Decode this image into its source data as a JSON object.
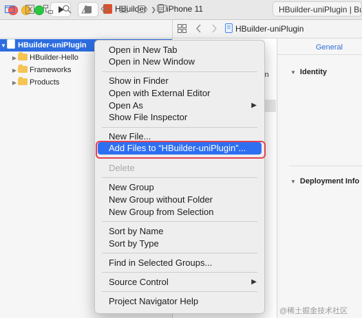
{
  "toolbar": {
    "run_icon": "play-icon",
    "stop_icon": "stop-icon",
    "scheme_name": "HBuilder",
    "scheme_separator": "❯",
    "device_name": "iPhone 11",
    "status_text": "HBuilder-uniPlugin | Build"
  },
  "navigator": {
    "icons": [
      "folder-icon",
      "source-control-icon",
      "hierarchy-icon",
      "search-icon",
      "warning-icon",
      "test-icon",
      "debug-icon",
      "breakpoint-icon",
      "report-icon"
    ],
    "tree": [
      {
        "label": "HBuilder-uniPlugin",
        "selected": true
      },
      {
        "label": "HBuilder-Hello"
      },
      {
        "label": "Frameworks"
      },
      {
        "label": "Products"
      }
    ]
  },
  "editor": {
    "breadcrumb": "HBuilder-uniPlugin",
    "partial_text": "in"
  },
  "inspector": {
    "tab": "General",
    "section_identity": "Identity",
    "section_deployment": "Deployment Info"
  },
  "context_menu": {
    "items": [
      "Open in New Tab",
      "Open in New Window",
      "Show in Finder",
      "Open with External Editor",
      "Open As",
      "Show File Inspector",
      "New File...",
      "Add Files to “HBuilder-uniPlugin”...",
      "Delete",
      "New Group",
      "New Group without Folder",
      "New Group from Selection",
      "Sort by Name",
      "Sort by Type",
      "Find in Selected Groups...",
      "Source Control",
      "Project Navigator Help"
    ]
  },
  "colors": {
    "selection": "#2d6de0",
    "menu_highlight": "#2e6ff2",
    "annotation": "#e63e4e"
  },
  "watermark": "@稀土掘金技术社区"
}
